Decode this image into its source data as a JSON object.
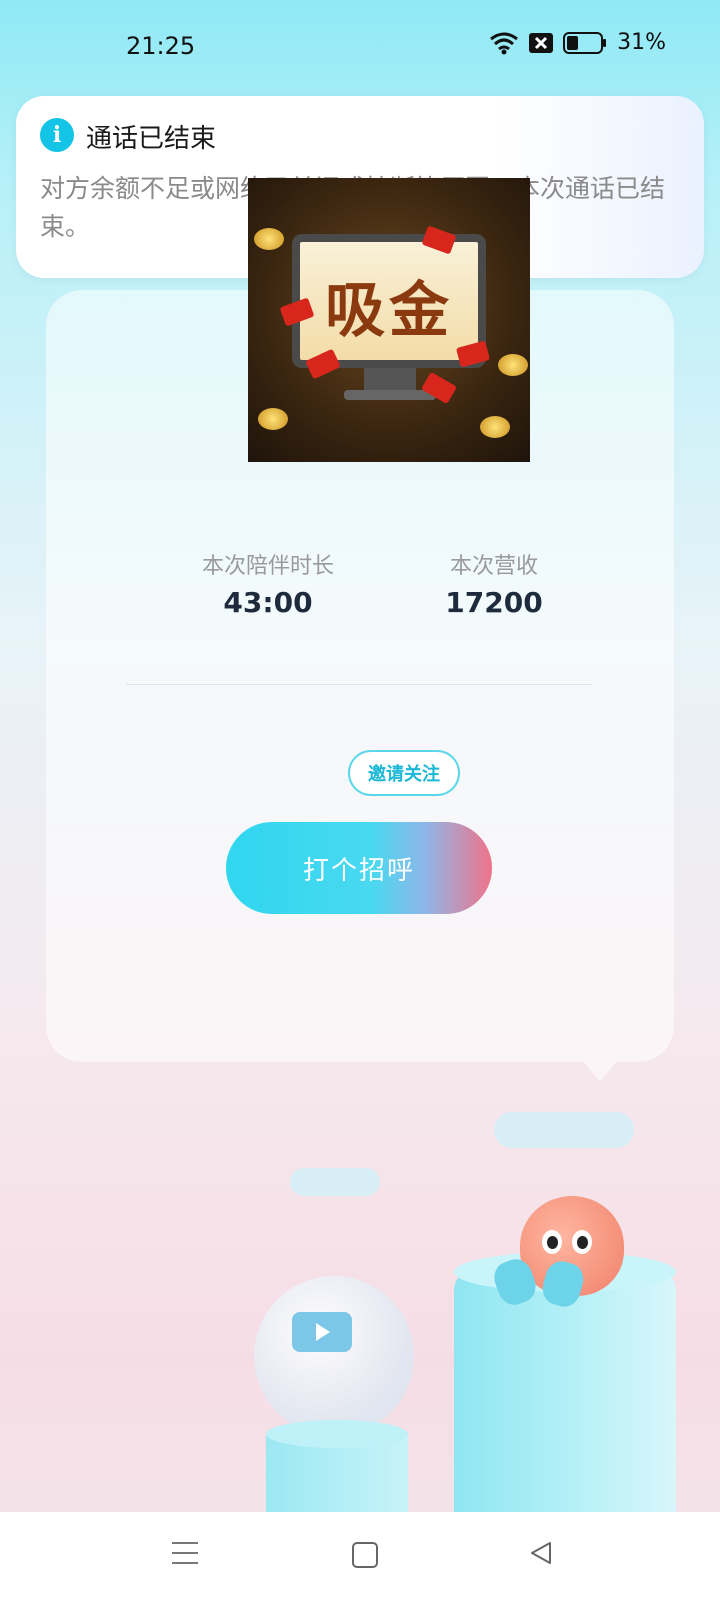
{
  "status_bar": {
    "time": "21:25",
    "battery": "31%"
  },
  "notification": {
    "title": "通话已结束",
    "body": "对方余额不足或网络已关闭或挂断等原因，本次通话已结束。"
  },
  "promo_banner": {
    "text": "吸金"
  },
  "card": {
    "invite_button": "邀请关注",
    "stats": [
      {
        "label": "本次陪伴时长",
        "value": "43:00"
      },
      {
        "label": "本次营收",
        "value": "17200"
      }
    ],
    "greet_button": "打个招呼"
  },
  "colors": {
    "accent": "#14c4e6",
    "greet_start": "#2fd7ef",
    "greet_end": "#f0738a"
  }
}
